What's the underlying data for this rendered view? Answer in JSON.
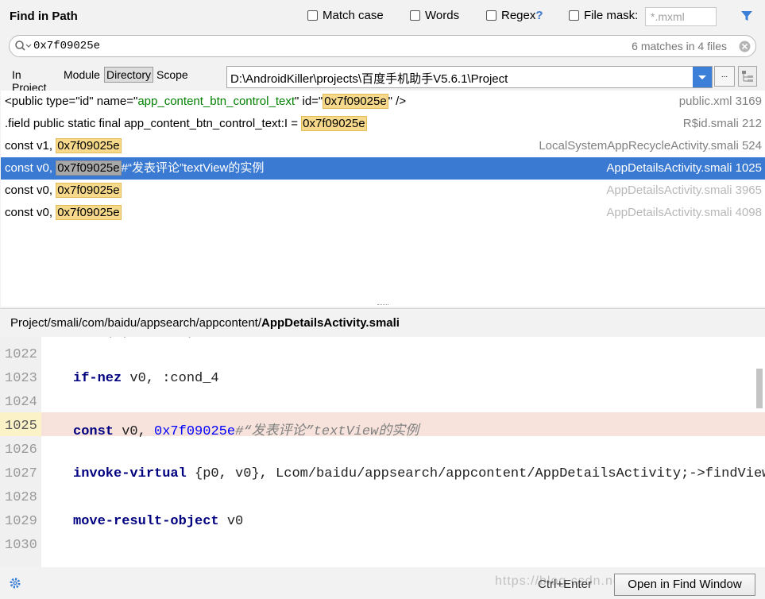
{
  "window": {
    "title": "Find in Path"
  },
  "options": {
    "match_case": "Match case",
    "words": "Words",
    "regex": "Regex",
    "regex_help": "?",
    "file_mask": "File mask:",
    "file_mask_value": "*.mxml"
  },
  "search": {
    "value": "0x7f09025e",
    "count": "6 matches in 4 files"
  },
  "scope": {
    "tabs": [
      "In Project",
      "Module",
      "Directory",
      "Scope"
    ],
    "selected": "Directory",
    "directory": "D:\\AndroidKiller\\projects\\百度手机助手V5.6.1\\Project",
    "browse_label": "..."
  },
  "results": [
    {
      "pre_a": "<public type=\"id\" name=\"",
      "mid_a": "app_content_btn_control_text",
      "pre_b": "\" id=\"",
      "match": "0x7f09025e",
      "post": "\" />",
      "file": "public.xml 3169"
    },
    {
      "pre": ".field public static final app_content_btn_control_text:I = ",
      "match": "0x7f09025e",
      "post": "",
      "file": "R$id.smali 212"
    },
    {
      "pre": "const v1, ",
      "match": "0x7f09025e",
      "post": "",
      "file": "LocalSystemAppRecycleActivity.smali 524"
    },
    {
      "pre": "const v0, ",
      "match": "0x7f09025e",
      "post": "#“发表评论”textView的实例",
      "file": "AppDetailsActivity.smali 1025"
    },
    {
      "pre": "const v0, ",
      "match": "0x7f09025e",
      "post": "",
      "file": "AppDetailsActivity.smali 3965"
    },
    {
      "pre": "const v0, ",
      "match": "0x7f09025e",
      "post": "",
      "file": "AppDetailsActivity.smali 4098"
    }
  ],
  "path": {
    "prefix": "Project/smali/com/baidu/appsearch/appcontent/",
    "file": "AppDetailsActivity.smali"
  },
  "code": {
    "line_numbers": [
      "1022",
      "1023",
      "1024",
      "1025",
      "1026",
      "1027",
      "1028",
      "1029",
      "1030"
    ],
    "lines": {
      "l1023_kw": "if-nez",
      "l1023_rest": " v0, :cond_4",
      "l1025_kw": "const",
      "l1025_rest": " v0, ",
      "l1025_num": "0x7f09025e",
      "l1025_cm": "#“发表评论”textView的实例",
      "l1027_kw": "invoke-virtual",
      "l1027_rest": " {p0, v0}, Lcom/baidu/appsearch/appcontent/AppDetailsActivity;->findView",
      "l1029_kw": "move-result-object",
      "l1029_rest": " v0"
    }
  },
  "bottom": {
    "shortcut": "Ctrl+Enter",
    "open_button": "Open in Find Window",
    "watermark": "https://blog.csdn.net/"
  },
  "colors": {
    "selection": "#3b7ad2",
    "highlight": "#f6d98a",
    "current_line": "#f7e3dc",
    "accent": "#3b7fd8"
  }
}
